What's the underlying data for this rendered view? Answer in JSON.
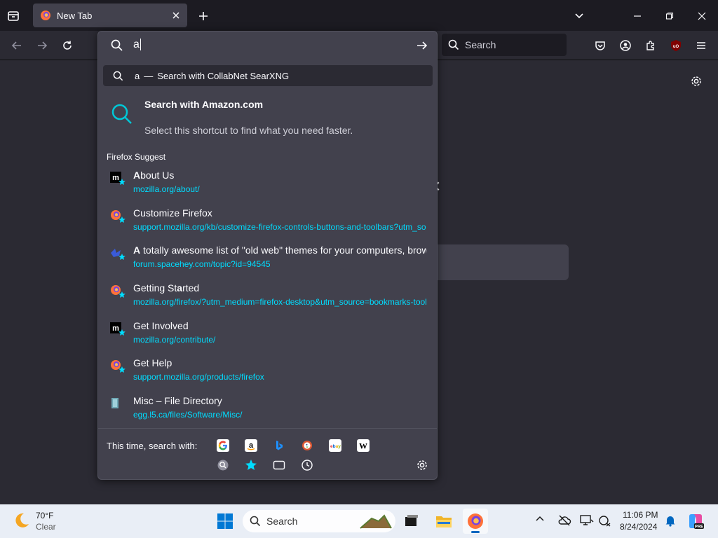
{
  "tab": {
    "title": "New Tab"
  },
  "toolbar": {
    "search_label": "Search"
  },
  "urlbar": {
    "typed": "a",
    "heuristic": {
      "query": "a",
      "sep": "—",
      "text": "Search with CollabNet SearXNG"
    },
    "tip": {
      "title": "Search with Amazon.com",
      "desc": "Select this shortcut to find what you need faster."
    },
    "suggest_label": "Firefox Suggest",
    "results": [
      {
        "pre": "",
        "bold": "A",
        "post": "bout Us",
        "url": "mozilla.org/about/",
        "icon": "mozilla-bookmark-icon"
      },
      {
        "pre": "Customize Firefox",
        "bold": "",
        "post": "",
        "url": "support.mozilla.org/kb/customize-firefox-controls-buttons-and-toolbars?utm_source=firefox",
        "icon": "firefox-bookmark-icon"
      },
      {
        "pre": "",
        "bold": "A",
        "post": " totally awesome list of \"old web\" themes for your computers, browsers",
        "url": "forum.spacehey.com/topic?id=94545",
        "icon": "spacehey-bookmark-icon"
      },
      {
        "pre": "Getting St",
        "bold": "a",
        "post": "rted",
        "url": "mozilla.org/firefox/?utm_medium=firefox-desktop&utm_source=bookmarks-toolbar",
        "icon": "firefox-bookmark-icon"
      },
      {
        "pre": "Get Involved",
        "bold": "",
        "post": "",
        "url": "mozilla.org/contribute/",
        "icon": "mozilla-bookmark-icon"
      },
      {
        "pre": "Get Help",
        "bold": "",
        "post": "",
        "url": "support.mozilla.org/products/firefox",
        "icon": "firefox-bookmark-icon"
      },
      {
        "pre": "Misc – File Directory",
        "bold": "",
        "post": "",
        "url": "egg.l5.ca/files/Software/Misc/",
        "icon": "file-icon"
      }
    ],
    "one_off_label": "This time, search with:",
    "engines": [
      "google-icon",
      "amazon-icon",
      "bing-icon",
      "duckduckgo-icon",
      "ebay-icon",
      "wikipedia-icon"
    ]
  },
  "taskbar": {
    "temp": "70°F",
    "condition": "Clear",
    "search_label": "Search",
    "time": "11:06 PM",
    "date": "8/24/2024"
  }
}
